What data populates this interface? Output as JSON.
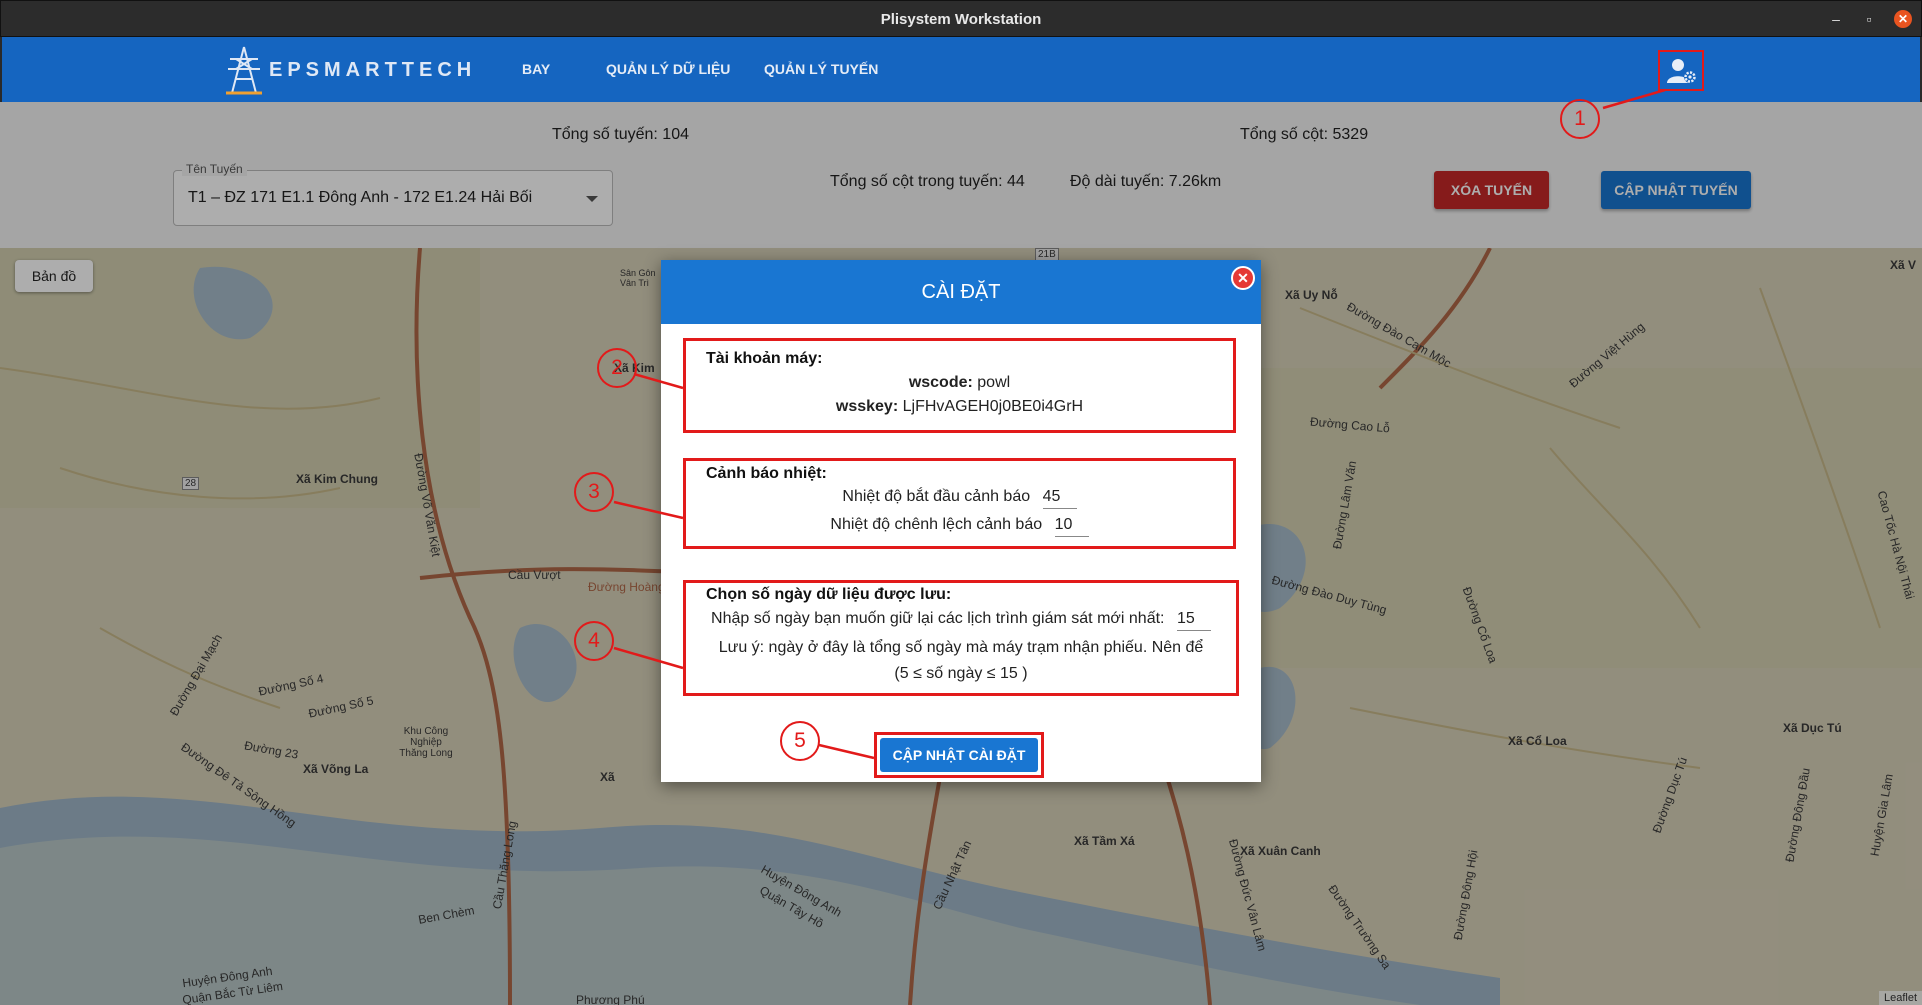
{
  "window": {
    "title": "Plisystem Workstation",
    "minimize": "–",
    "maximize": "▫",
    "close": "✕"
  },
  "navbar": {
    "brand": "EPSMARTTECH",
    "items": [
      "BAY",
      "QUẢN LÝ DỮ LIỆU",
      "QUẢN LÝ TUYẾN"
    ],
    "settings_icon": "user-gear-icon"
  },
  "info": {
    "total_lines": "Tổng số tuyến: 104",
    "total_poles": "Tổng số cột: 5329",
    "poles_in_line": "Tổng số cột trong tuyến: 44",
    "line_length": "Độ dài tuyến: 7.26km",
    "select_label": "Tên Tuyến",
    "select_value": "T1 – ĐZ 171 E1.1 Đông Anh - 172 E1.24 Hải Bối",
    "delete_button": "XÓA TUYẾN",
    "update_button": "CẬP NHẬT TUYẾN"
  },
  "map": {
    "layer_button": "Bản đồ",
    "attribution": "Leaflet",
    "labels": [
      "Xã Kim Chung",
      "Xã Uy Nỗ",
      "Xã Võng La",
      "Xã Tầm Xá",
      "Xã Xuân Canh",
      "Xã Cổ Loa",
      "Xã Dục Tú",
      "Xã Kim",
      "Xã V",
      "Xã",
      "Cầu Vượt",
      "Đường Hoàng",
      "Đường Cao Lỗ",
      "Đường Đào Duy Tùng",
      "Đường Đào Cam Mộc",
      "Đường Việt Hùng",
      "Đường Cổ Loa",
      "Đường Võ Văn Kiệt",
      "Đường Đại Mạch",
      "Đường Số 4",
      "Đường Số 5",
      "Đường 23",
      "Đường Đê Tả Sông Hồng",
      "Khu Công Nghiệp Thăng Long",
      "Cầu Thăng Long",
      "Cầu Nhật Tân",
      "Huyện Đông Anh",
      "Quận Tây Hồ",
      "Huyện Đông Anh",
      "Quận Bắc Từ Liêm",
      "Đường Trường Sa",
      "Đường Đông Hội",
      "Đường Đức Vân Lâm",
      "Đường Đông Đầu",
      "Huyện Gia Lâm",
      "Ben Chèm",
      "Phương Phú",
      "Sân Gôn Vân Trì",
      "Đường Lâm Văn",
      "Đường Dục Tú",
      "Cao Tốc Hà Nội Thái",
      "28",
      "21B"
    ]
  },
  "modal": {
    "title": "CÀI ĐẶT",
    "close": "✕",
    "account": {
      "title": "Tài khoản máy:",
      "wscode_label": "wscode:",
      "wscode_value": "powl",
      "wsskey_label": "wsskey:",
      "wsskey_value": "LjFHvAGEH0j0BE0i4GrH"
    },
    "heat": {
      "title": "Cảnh báo nhiệt:",
      "start_label": "Nhiệt độ bắt đầu cảnh báo",
      "start_value": "45",
      "diff_label": "Nhiệt độ chênh lệch cảnh báo",
      "diff_value": "10"
    },
    "retention": {
      "title": "Chọn số ngày dữ liệu được lưu:",
      "prompt": "Nhập số ngày bạn muốn giữ lại các lịch trình giám sát mới nhất:",
      "value": "15",
      "note": "Lưu ý: ngày ở đây là tổng số ngày mà máy trạm nhận phiếu. Nên để",
      "range": "(5 ≤ số ngày ≤ 15 )"
    },
    "submit": "CẬP NHẬT CÀI ĐẶT"
  },
  "callouts": [
    "1",
    "2",
    "3",
    "4",
    "5"
  ],
  "colors": {
    "navbar": "#1565c0",
    "primary": "#1976d2",
    "danger": "#c62828",
    "annotation": "#e21a1a"
  }
}
